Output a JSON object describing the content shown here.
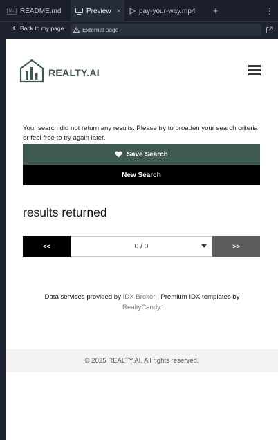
{
  "browser": {
    "tabs": [
      {
        "tag": "M↓",
        "label": "README.md"
      },
      {
        "label": "Preview",
        "close": "×"
      },
      {
        "label": "pay-your-way.mp4"
      }
    ],
    "new_tab": "+",
    "more": "⋮",
    "back_label": "Back to my page",
    "url_label": "External page"
  },
  "site": {
    "logo_text": "REALTY.AI",
    "no_results_message": "Your search did not return any results. Please try to broaden your search criteria or feel free to try again later.",
    "save_search_label": "Save Search",
    "new_search_label": "New Search",
    "results_heading": "results returned",
    "pagination": {
      "prev": "<<",
      "page": "0 / 0",
      "next": ">>"
    },
    "credits": {
      "prefix": "Data services provided by ",
      "idx_link": "IDX Broker",
      "middle": " | Premium IDX templates by ",
      "rc_link": "RealtyCandy",
      "suffix": "."
    },
    "footer": "© 2025 REALTY.AI. All rights reserved."
  },
  "colors": {
    "brand_green": "#3f5a4f",
    "next_button": "#5c5c5c"
  }
}
